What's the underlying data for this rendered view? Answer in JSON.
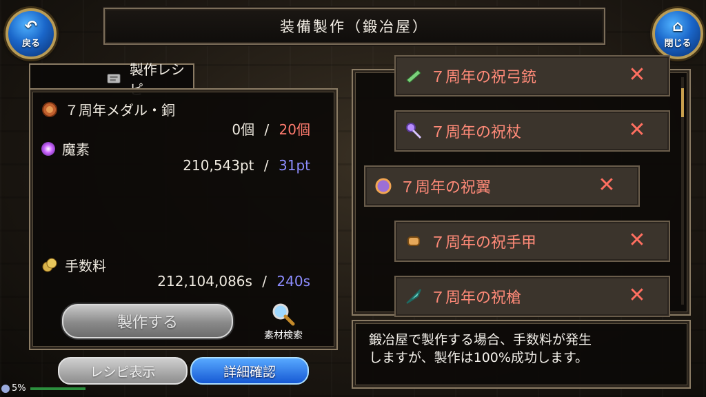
{
  "header": {
    "title": "装備製作（鍛冶屋）"
  },
  "nav": {
    "back_label": "戻る",
    "close_label": "閉じる"
  },
  "recipe": {
    "tab_label": "製作レシピ",
    "materials": [
      {
        "name": "７周年メダル・銅",
        "have": "0個",
        "sep": "/",
        "need": "20個",
        "need_color": "#ff7b6e"
      },
      {
        "name": "魔素",
        "have": "210,543pt",
        "sep": "/",
        "need": "31pt",
        "need_color": "#8d8dff"
      },
      {
        "name": "手数料",
        "have": "212,104,086s",
        "sep": "/",
        "need": "240s",
        "need_color": "#8d8dff"
      }
    ],
    "craft_button": "製作する",
    "search_label": "素材検索"
  },
  "bottom_buttons": {
    "recipe_show": "レシピ表示",
    "detail_check": "詳細確認"
  },
  "items": [
    {
      "name": "７周年の祝弓銃",
      "icon": "bowgun-icon",
      "selected": false
    },
    {
      "name": "７周年の祝杖",
      "icon": "staff-icon",
      "selected": false
    },
    {
      "name": "７周年の祝翼",
      "icon": "wing-icon",
      "selected": true
    },
    {
      "name": "７周年の祝手甲",
      "icon": "gauntlet-icon",
      "selected": false
    },
    {
      "name": "７周年の祝槍",
      "icon": "spear-icon",
      "selected": false
    }
  ],
  "unavailable_mark": "✕",
  "info": {
    "line1": "鍛冶屋で製作する場合、手数料が発生",
    "line2": "しますが、製作は100%成功します。"
  },
  "status": {
    "battery": "5%"
  }
}
